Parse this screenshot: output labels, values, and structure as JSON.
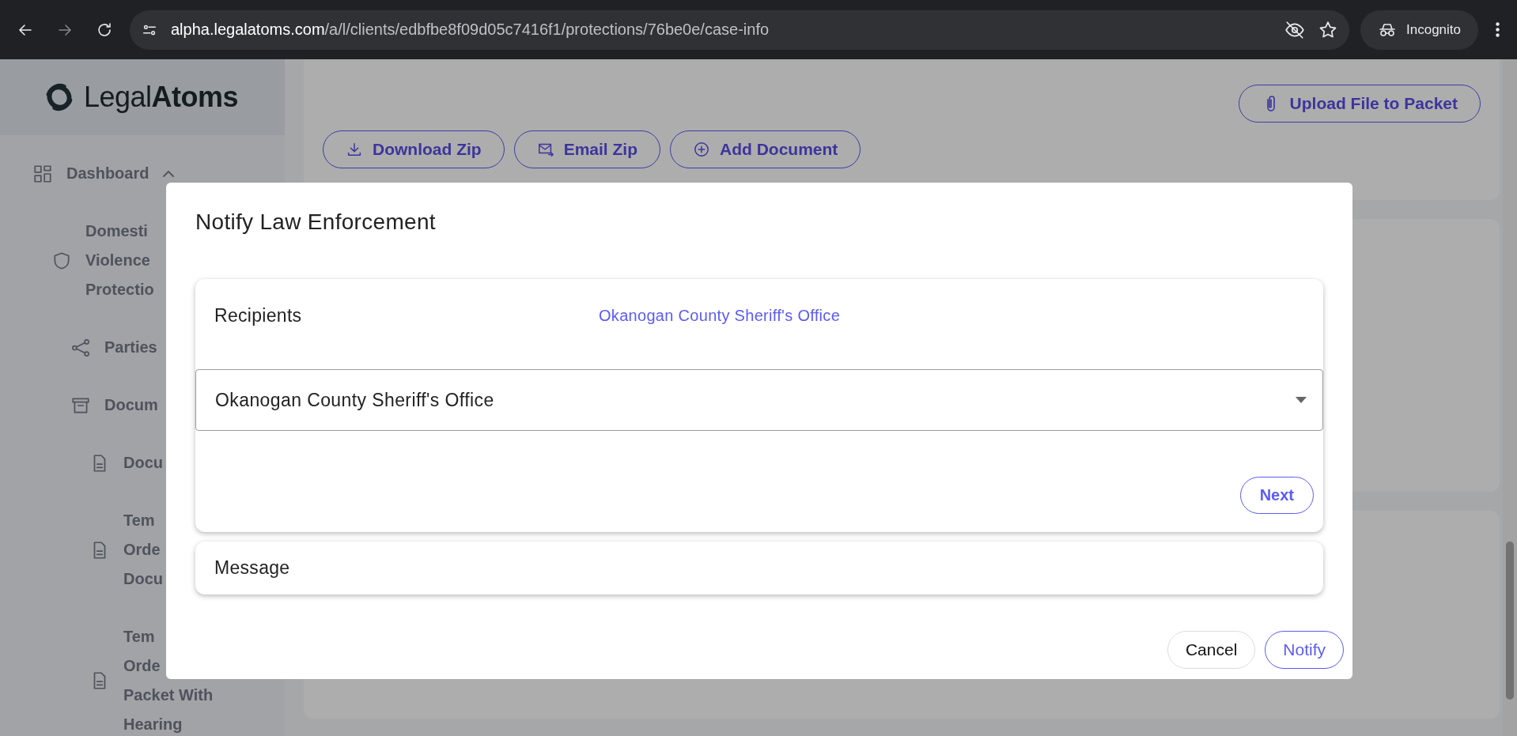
{
  "browser": {
    "url_host": "alpha.legalatoms.com",
    "url_path": "/a/l/clients/edbfbe8f09d05c7416f1/protections/76be0e/case-info",
    "profile": "Incognito"
  },
  "sidebar": {
    "logo": {
      "light": "Legal",
      "bold": "Atoms"
    },
    "items": [
      {
        "kind": "dashboard",
        "lines": [
          "Dashboard"
        ],
        "expanded": true,
        "children": [
          {
            "kind": "case",
            "lines": [
              "Domesti",
              "Violence",
              "Protectio"
            ],
            "children": [
              {
                "kind": "parties",
                "lines": [
                  "Parties"
                ]
              },
              {
                "kind": "folder",
                "lines": [
                  "Docum"
                ],
                "children": [
                  {
                    "kind": "document",
                    "lines": [
                      "Docu"
                    ]
                  },
                  {
                    "kind": "document",
                    "lines": [
                      "Tem",
                      "Orde",
                      "Docu"
                    ]
                  },
                  {
                    "kind": "document",
                    "lines": [
                      "Tem",
                      "Orde",
                      "Packet With",
                      "Hearing"
                    ]
                  }
                ]
              }
            ]
          }
        ]
      }
    ]
  },
  "toolbar": {
    "upload": "Upload File to Packet",
    "buttons": [
      {
        "kind": "download",
        "label": "Download Zip"
      },
      {
        "kind": "email",
        "label": "Email Zip"
      },
      {
        "kind": "add",
        "label": "Add Document"
      }
    ]
  },
  "dialog": {
    "title": "Notify Law Enforcement",
    "recipients": {
      "label": "Recipients",
      "value": "Okanogan County Sheriff's Office"
    },
    "select": {
      "value": "Okanogan County Sheriff's Office"
    },
    "next": "Next",
    "message": {
      "label": "Message"
    },
    "actions": [
      {
        "kind": "secondary",
        "label": "Cancel"
      },
      {
        "kind": "primary",
        "label": "Notify"
      }
    ]
  }
}
